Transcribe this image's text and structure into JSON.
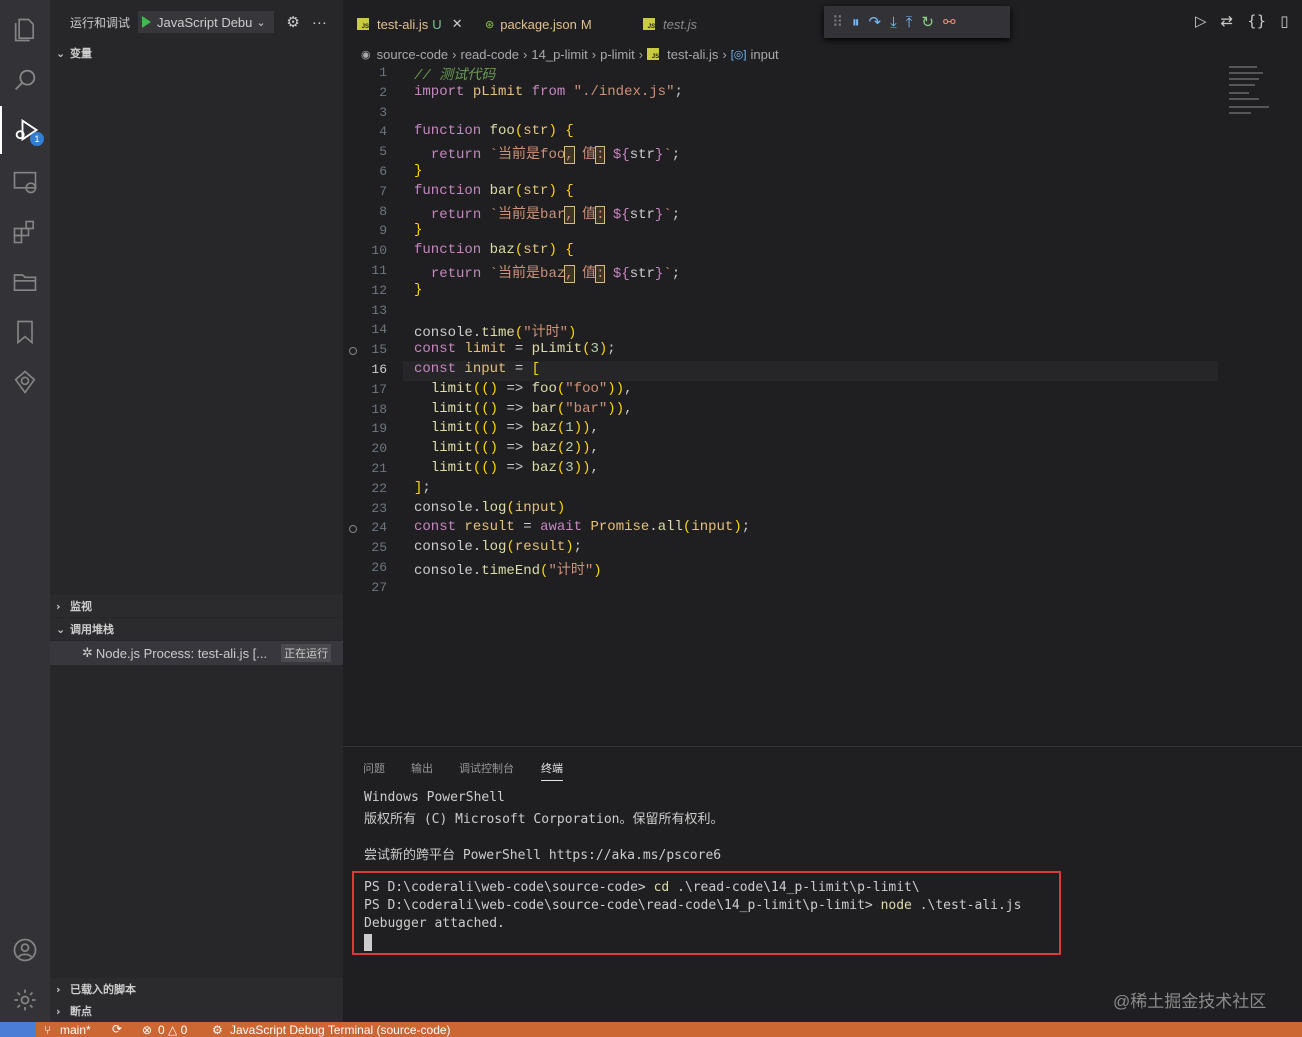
{
  "sidebar": {
    "title": "运行和调试",
    "config": "JavaScript Debu",
    "variables": "变量",
    "watch": "监视",
    "callstack": "调用堆栈",
    "process_name": "Node.js Process: test-ali.js [...",
    "process_state": "正在运行",
    "loaded_scripts": "已载入的脚本",
    "breakpoints": "断点",
    "debug_badge": "1"
  },
  "tabs": [
    {
      "label": "test-ali.js",
      "status": "U"
    },
    {
      "label": "package.json",
      "status": "M"
    },
    {
      "label": "test.js",
      "status": ""
    }
  ],
  "breadcrumb": [
    "source-code",
    "read-code",
    "14_p-limit",
    "p-limit",
    "test-ali.js",
    "input"
  ],
  "editor": {
    "line_numbers": [
      "1",
      "2",
      "3",
      "4",
      "5",
      "6",
      "7",
      "8",
      "9",
      "10",
      "11",
      "12",
      "13",
      "14",
      "15",
      "16",
      "17",
      "18",
      "19",
      "20",
      "21",
      "22",
      "23",
      "24",
      "25",
      "26",
      "27"
    ],
    "lines": [
      "// 测试代码",
      "import pLimit from \"./index.js\";",
      "",
      "function foo(str) {",
      "  return `当前是foo, 值: ${str}`;",
      "}",
      "function bar(str) {",
      "  return `当前是bar, 值: ${str}`;",
      "}",
      "function baz(str) {",
      "  return `当前是baz, 值: ${str}`;",
      "}",
      "",
      "console.time(\"计时\")",
      "const limit = pLimit(3);",
      "const input = [",
      "  limit(() => foo(\"foo\")),",
      "  limit(() => bar(\"bar\")),",
      "  limit(() => baz(1)),",
      "  limit(() => baz(2)),",
      "  limit(() => baz(3)),",
      "];",
      "console.log(input)",
      "const result = await Promise.all(input);",
      "console.log(result);",
      "console.timeEnd(\"计时\")",
      ""
    ]
  },
  "panel": {
    "tabs": [
      "问题",
      "输出",
      "调试控制台",
      "终端"
    ],
    "terminal": [
      "Windows PowerShell",
      "版权所有 (C) Microsoft Corporation。保留所有权利。",
      "",
      "尝试新的跨平台 PowerShell https://aka.ms/pscore6",
      "",
      "PS D:\\coderali\\web-code\\source-code> cd .\\read-code\\14_p-limit\\p-limit\\",
      "PS D:\\coderali\\web-code\\source-code\\read-code\\14_p-limit\\p-limit> node .\\test-ali.js",
      "Debugger attached."
    ],
    "watermark": "@稀土掘金技术社区"
  },
  "status": {
    "branch": "main*",
    "problems": "0 △ 0",
    "terminal": "JavaScript Debug Terminal (source-code)"
  },
  "colors": {
    "accent": "#cc6633",
    "highlight_box": "#d93a3a"
  }
}
